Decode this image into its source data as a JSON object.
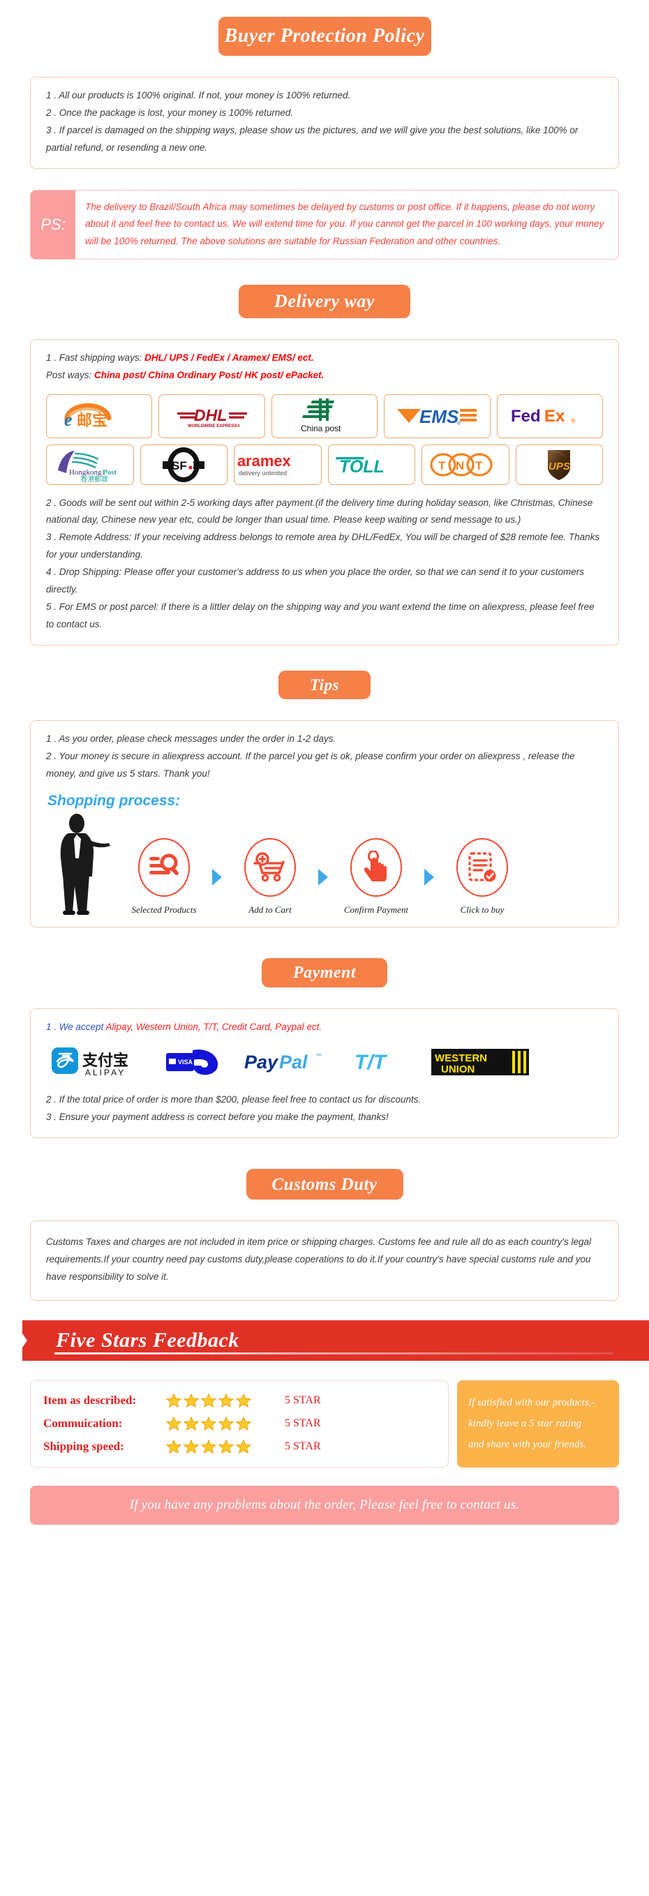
{
  "colors": {
    "accent_orange": "#F58048",
    "card_border": "#F3CBB3",
    "ps_pink": "#F99D9D",
    "ps_text_red": "#F4433C",
    "emphasis_red": "#FF0000",
    "blue_heading": "#35A7E8",
    "banner_red": "#E03127",
    "satisfied_orange": "#FBB249",
    "contact_pink": "#FB9E9E",
    "star_gold": "#FFC928"
  },
  "buyer_protection": {
    "heading": "Buyer Protection Policy",
    "items": [
      "1 . All our products is 100% original. If not, your money is 100% returned.",
      "2 . Once the package is lost, your money is 100% returned.",
      "3 . If parcel is damaged on the shipping ways, please show us the pictures, and we will give you the best solutions, like 100% or partial refund, or resending a new one."
    ]
  },
  "ps": {
    "label": "PS:",
    "text": "The delivery to Brazil/South Africa may sometimes be delayed by customs or post office. If it happens, please do not worry about it and feel free to contact us. We will extend time for you. If you cannot get the parcel in 100 working days, your money will be 100% returned. The above solutions are suitable for Russian Federation and other countries."
  },
  "delivery": {
    "heading": "Delivery way",
    "fast_prefix": "1 . Fast shipping ways: ",
    "fast_value": "DHL/ UPS / FedEx / Aramex/ EMS/ ect.",
    "post_prefix": "Post ways: ",
    "post_value": "China post/ China Ordinary Post/ HK post/ ePacket.",
    "carriers_row1": [
      {
        "name": "epacket-logo",
        "label": "e邮宝"
      },
      {
        "name": "dhl-logo",
        "label": "DHL"
      },
      {
        "name": "china-post-logo",
        "label": "China post"
      },
      {
        "name": "ems-logo",
        "label": "EMS"
      },
      {
        "name": "fedex-logo",
        "label": "FedEx"
      }
    ],
    "carriers_row2": [
      {
        "name": "hongkong-post-logo",
        "label": "Hongkong Post 香港郵政"
      },
      {
        "name": "sf-express-logo",
        "label": "SF"
      },
      {
        "name": "aramex-logo",
        "label": "aramex delivery unlimited"
      },
      {
        "name": "toll-logo",
        "label": "TOLL"
      },
      {
        "name": "tnt-logo",
        "label": "TNT"
      },
      {
        "name": "ups-logo",
        "label": "UPS"
      }
    ],
    "items": [
      "2 . Goods will be sent out within 2-5 working days after payment.(if the delivery time during holiday season, like Christmas, Chinese national day, Chinese new year etc, could be longer than usual time. Please keep waiting or send message to us.)",
      "3 . Remote Address: If your receiving address belongs to remote area by DHL/FedEx, You will be charged of $28 remote fee. Thanks for your understanding.",
      "4 . Drop Shipping: Please offer your customer's address to us when you place the order, so that we can send it to your customers directly.",
      "5 . For EMS or post parcel: if there is a littler delay on the shipping way and you want extend the time on aliexpress, please feel free to contact us."
    ]
  },
  "tips": {
    "heading": "Tips",
    "items": [
      "1 .  As you order, please check messages under the order in 1-2 days.",
      "2 . Your money is secure in aliexpress account. If the parcel you get is ok, please confirm your order on aliexpress , release the money, and give us 5 stars. Thank you!"
    ],
    "process_title": "Shopping process:",
    "steps": [
      {
        "icon": "search-list-icon",
        "label": "Selected Products"
      },
      {
        "icon": "add-to-cart-icon",
        "label": "Add to Cart"
      },
      {
        "icon": "hand-tap-icon",
        "label": "Confirm Payment"
      },
      {
        "icon": "checklist-icon",
        "label": "Click to buy"
      }
    ]
  },
  "payment": {
    "heading": "Payment",
    "accept_prefix": "1 . We accept ",
    "accept_value": "Alipay, Western Union, T/T, Credit Card, Paypal ect.",
    "methods": [
      {
        "name": "alipay-logo",
        "label": "支付宝 ALIPAY"
      },
      {
        "name": "credit-card-visa-logo",
        "label": "VISA"
      },
      {
        "name": "paypal-logo",
        "label": "PayPal"
      },
      {
        "name": "tt-logo",
        "label": "T/T"
      },
      {
        "name": "western-union-logo",
        "label": "WESTERN UNION"
      }
    ],
    "items": [
      "2 . If the total price of order is more than $200, please feel free to contact us for discounts.",
      "3 . Ensure your payment address is correct before you make the payment, thanks!"
    ]
  },
  "customs": {
    "heading": "Customs Duty",
    "text": "Customs Taxes and charges are not included in item price or shipping charges. Customs fee and rule all do as each country's legal requirements.If your country need pay customs duty,please coperations to do it.If your country's have special customs rule and you have responsibility to solve it."
  },
  "feedback": {
    "banner_title": "Five Stars Feedback",
    "rows": [
      {
        "label": "Item as described:",
        "stars": 5,
        "value": "5 STAR"
      },
      {
        "label": "Commuication:",
        "stars": 5,
        "value": "5 STAR"
      },
      {
        "label": "Shipping speed:",
        "stars": 5,
        "value": "5 STAR"
      }
    ],
    "satisfied_lines": [
      "If satisfied with our products,-",
      "kindly leave a 5 star rating",
      "and share with your friends."
    ]
  },
  "contact": {
    "text": "If you have any problems about the order, Please feel free to contact us."
  }
}
